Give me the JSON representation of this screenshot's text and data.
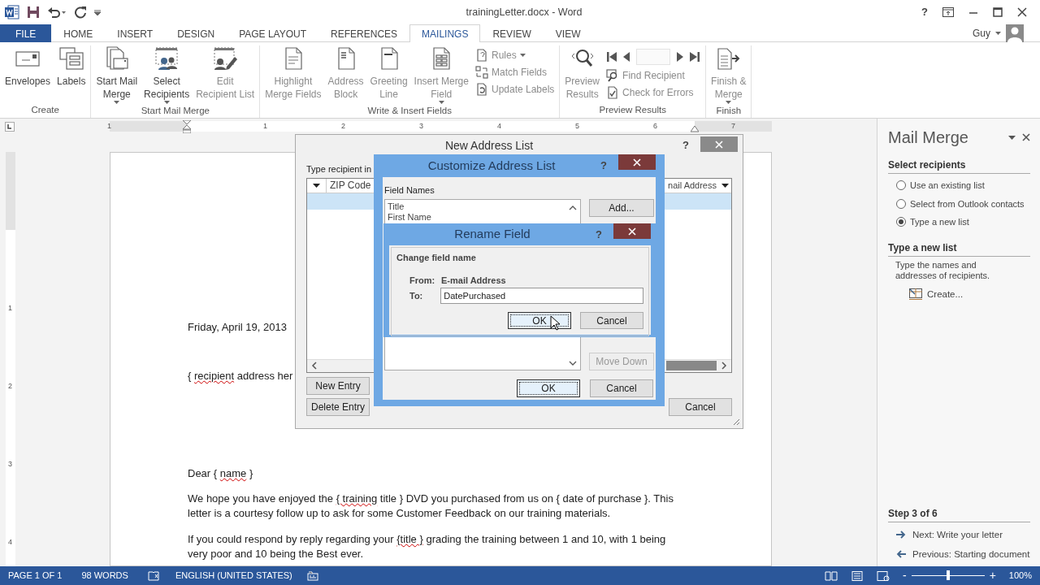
{
  "window": {
    "title": "trainingLetter.docx - Word",
    "help": "?",
    "user": "Guy"
  },
  "tabs": [
    {
      "label": "FILE",
      "kind": "file",
      "selected": false
    },
    {
      "label": "HOME",
      "kind": "tab",
      "selected": false
    },
    {
      "label": "INSERT",
      "kind": "tab",
      "selected": false
    },
    {
      "label": "DESIGN",
      "kind": "tab",
      "selected": false
    },
    {
      "label": "PAGE LAYOUT",
      "kind": "tab",
      "selected": false
    },
    {
      "label": "REFERENCES",
      "kind": "tab",
      "selected": false
    },
    {
      "label": "MAILINGS",
      "kind": "tab",
      "selected": true
    },
    {
      "label": "REVIEW",
      "kind": "tab",
      "selected": false
    },
    {
      "label": "VIEW",
      "kind": "tab",
      "selected": false
    }
  ],
  "ribbon": [
    {
      "group": "Create",
      "items": [
        {
          "kind": "large",
          "lines": [
            "Envelopes"
          ],
          "dropdown": false,
          "disabled": false
        },
        {
          "kind": "large",
          "lines": [
            "Labels"
          ],
          "dropdown": false,
          "disabled": false
        }
      ]
    },
    {
      "group": "Start Mail Merge",
      "items": [
        {
          "kind": "large",
          "lines": [
            "Start Mail",
            "Merge"
          ],
          "dropdown": true,
          "disabled": false
        },
        {
          "kind": "large",
          "lines": [
            "Select",
            "Recipients"
          ],
          "dropdown": true,
          "disabled": false
        },
        {
          "kind": "large",
          "lines": [
            "Edit",
            "Recipient List"
          ],
          "dropdown": false,
          "disabled": true
        }
      ]
    },
    {
      "group": "Write & Insert Fields",
      "items": [
        {
          "kind": "large",
          "lines": [
            "Highlight",
            "Merge Fields"
          ],
          "dropdown": false,
          "disabled": true
        },
        {
          "kind": "large",
          "lines": [
            "Address",
            "Block"
          ],
          "dropdown": false,
          "disabled": true
        },
        {
          "kind": "large",
          "lines": [
            "Greeting",
            "Line"
          ],
          "dropdown": false,
          "disabled": true
        },
        {
          "kind": "large",
          "lines": [
            "Insert Merge",
            "Field"
          ],
          "dropdown": true,
          "disabled": true
        },
        {
          "kind": "stack",
          "items": [
            {
              "label": "Rules",
              "dropdown": true,
              "disabled": true
            },
            {
              "label": "Match Fields",
              "dropdown": false,
              "disabled": true
            },
            {
              "label": "Update Labels",
              "dropdown": false,
              "disabled": true
            }
          ]
        }
      ]
    },
    {
      "group": "Preview Results",
      "items": [
        {
          "kind": "large",
          "lines": [
            "Preview",
            "Results"
          ],
          "dropdown": false,
          "disabled": true
        },
        {
          "kind": "navstack",
          "items": [
            {
              "label": "Find Recipient",
              "dropdown": false,
              "disabled": true
            },
            {
              "label": "Check for Errors",
              "dropdown": false,
              "disabled": true
            }
          ]
        }
      ]
    },
    {
      "group": "Finish",
      "items": [
        {
          "kind": "large",
          "lines": [
            "Finish &",
            "Merge"
          ],
          "dropdown": true,
          "disabled": true
        }
      ]
    }
  ],
  "ruler": {
    "horizontal": [
      "1",
      "1",
      "2",
      "3",
      "4",
      "5",
      "6",
      "7"
    ],
    "vertical": [
      "1",
      "2",
      "3",
      "4"
    ]
  },
  "document": {
    "paragraphs": [
      {
        "spans": [
          {
            "text": "Friday, April 19, 2013",
            "misspelled": false
          }
        ]
      },
      {
        "spans": [
          {
            "text": "{ ",
            "misspelled": false
          },
          {
            "text": "recipient",
            "misspelled": true
          },
          {
            "text": " address her",
            "misspelled": false
          }
        ]
      },
      {
        "spans": [
          {
            "text": "Dear { ",
            "misspelled": false
          },
          {
            "text": "name",
            "misspelled": true
          },
          {
            "text": " }",
            "misspelled": false
          }
        ]
      },
      {
        "spans": [
          {
            "text": "We hope you have enjoyed the ",
            "misspelled": false
          },
          {
            "text": "{ training",
            "misspelled": true
          },
          {
            "text": " title } DVD you purchased from us on { date of purchase }. This letter is a courtesy follow up to ask for some Customer Feedback on our training materials.",
            "misspelled": false
          }
        ]
      },
      {
        "spans": [
          {
            "text": "If you could respond by reply regarding your ",
            "misspelled": false
          },
          {
            "text": "{title }",
            "misspelled": true
          },
          {
            "text": " grading the training between 1 and 10, with 1 being very poor and 10 being the Best ever.",
            "misspelled": false
          }
        ]
      }
    ]
  },
  "new_address_list": {
    "title": "New Address List",
    "help": "?",
    "instruction": "Type recipient in",
    "columns": [
      "ZIP Code",
      "nail Address"
    ],
    "buttons": [
      "New Entry",
      "Delete Entry",
      "Cancel"
    ]
  },
  "customize_address_list": {
    "title": "Customize Address List",
    "help": "?",
    "field_names_label": "Field Names",
    "fields": [
      "Title",
      "First Name"
    ],
    "side_buttons": [
      {
        "label": "Add...",
        "disabled": false
      },
      {
        "label": "Move Down",
        "disabled": true
      }
    ],
    "ok": "OK",
    "cancel": "Cancel"
  },
  "rename_field": {
    "title": "Rename Field",
    "help": "?",
    "group": "Change field name",
    "from_label": "From:",
    "from_value": "E-mail Address",
    "to_label": "To:",
    "to_value": "DatePurchased",
    "ok": "OK",
    "cancel": "Cancel"
  },
  "task_pane": {
    "title": "Mail Merge",
    "select_heading": "Select recipients",
    "options": [
      {
        "label": "Use an existing list",
        "selected": false
      },
      {
        "label": "Select from Outlook contacts",
        "selected": false
      },
      {
        "label": "Type a new list",
        "selected": true
      }
    ],
    "section_heading": "Type a new list",
    "section_text": "Type the names and addresses of recipients.",
    "link": "Create...",
    "step": "Step 3 of 6",
    "next": "Next: Write your letter",
    "previous": "Previous: Starting document"
  },
  "status_bar": {
    "page": "PAGE 1 OF 1",
    "words": "98 WORDS",
    "language": "ENGLISH (UNITED STATES)",
    "zoom_out": "-",
    "zoom_in": "+",
    "zoom": "100%",
    "zoom_slider": {
      "level": 0.5
    }
  }
}
